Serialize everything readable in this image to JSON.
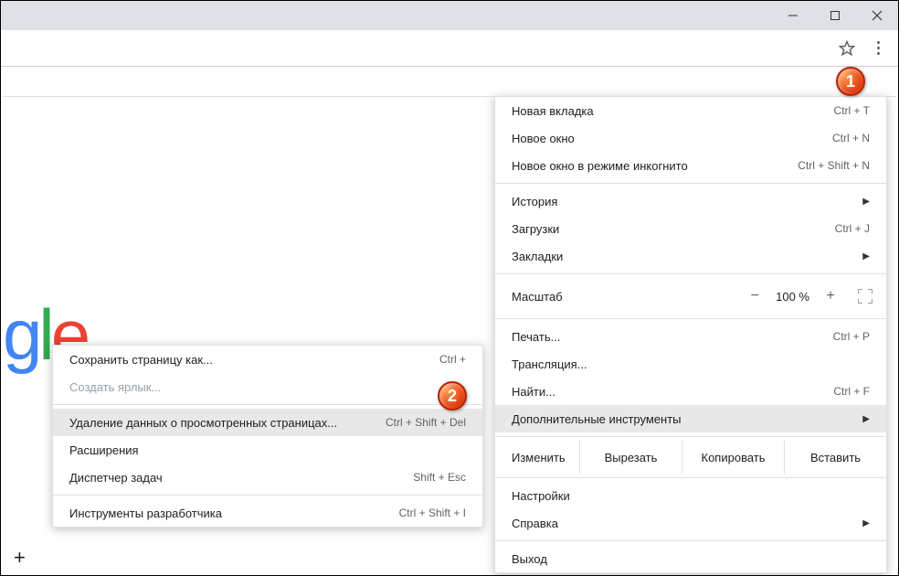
{
  "menu": {
    "new_tab": {
      "label": "Новая вкладка",
      "shortcut": "Ctrl + T"
    },
    "new_window": {
      "label": "Новое окно",
      "shortcut": "Ctrl + N"
    },
    "incognito": {
      "label": "Новое окно в режиме инкогнито",
      "shortcut": "Ctrl + Shift + N"
    },
    "history": {
      "label": "История"
    },
    "downloads": {
      "label": "Загрузки",
      "shortcut": "Ctrl + J"
    },
    "bookmarks": {
      "label": "Закладки"
    },
    "zoom": {
      "label": "Масштаб",
      "value": "100 %",
      "minus": "−",
      "plus": "+"
    },
    "print": {
      "label": "Печать...",
      "shortcut": "Ctrl + P"
    },
    "cast": {
      "label": "Трансляция..."
    },
    "find": {
      "label": "Найти...",
      "shortcut": "Ctrl + F"
    },
    "more_tools": {
      "label": "Дополнительные инструменты"
    },
    "edit": {
      "label": "Изменить",
      "cut": "Вырезать",
      "copy": "Копировать",
      "paste": "Вставить"
    },
    "settings": {
      "label": "Настройки"
    },
    "help": {
      "label": "Справка"
    },
    "exit": {
      "label": "Выход"
    }
  },
  "submenu": {
    "save_as": {
      "label": "Сохранить страницу как...",
      "shortcut": "Ctrl + "
    },
    "create_shortcut": {
      "label": "Создать ярлык..."
    },
    "clear_data": {
      "label": "Удаление данных о просмотренных страницах...",
      "shortcut": "Ctrl + Shift + Del"
    },
    "extensions": {
      "label": "Расширения"
    },
    "task_manager": {
      "label": "Диспетчер задач",
      "shortcut": "Shift + Esc"
    },
    "dev_tools": {
      "label": "Инструменты разработчика",
      "shortcut": "Ctrl + Shift + I"
    }
  },
  "logo": {
    "g": "g",
    "l": "l",
    "e": "e"
  },
  "badges": {
    "one": "1",
    "two": "2"
  }
}
